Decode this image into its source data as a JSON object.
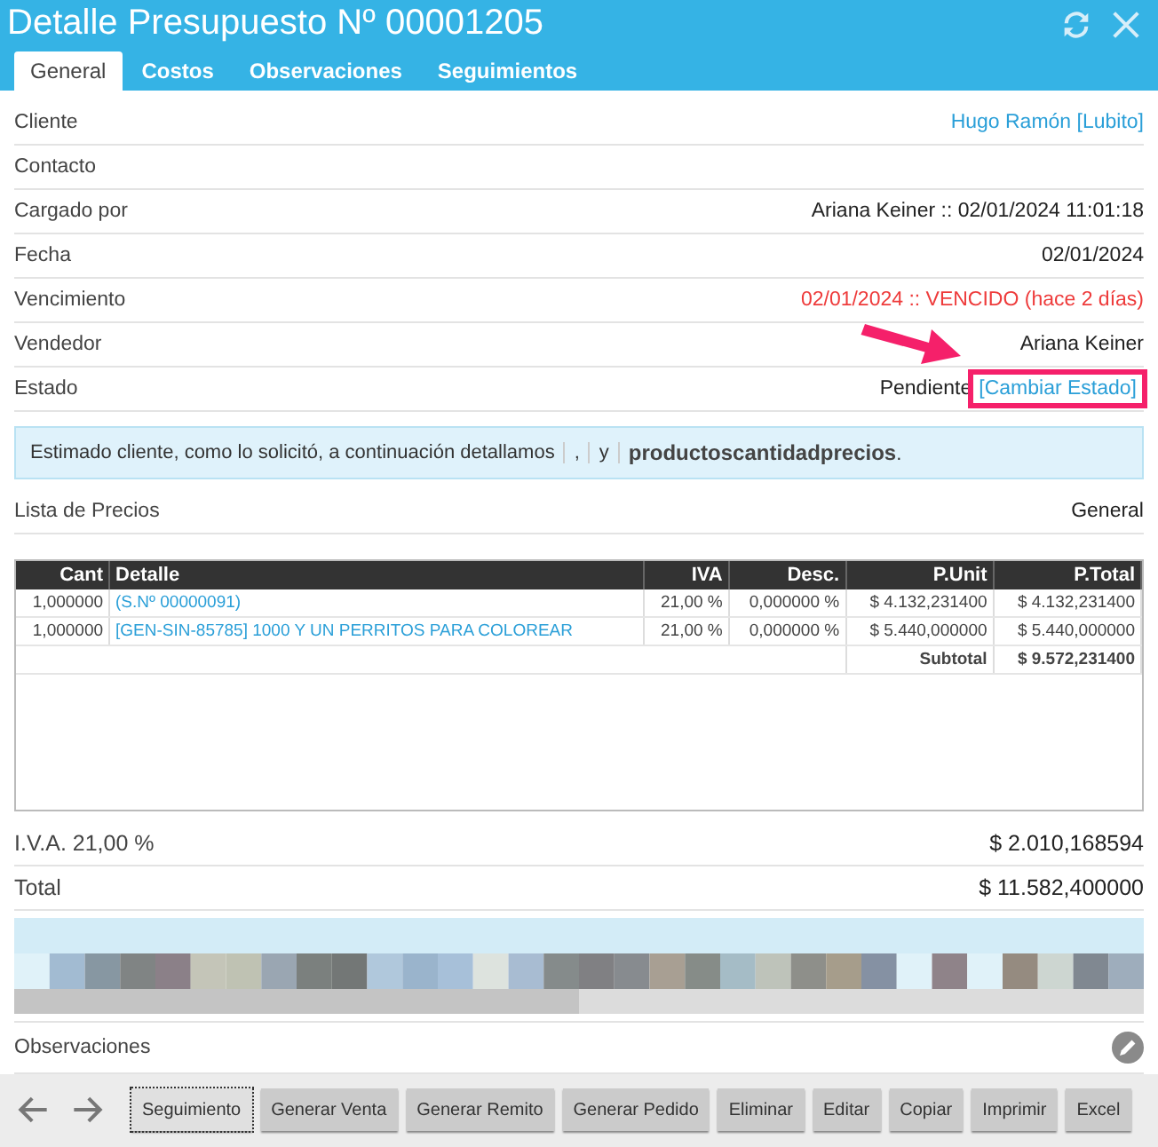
{
  "window": {
    "title": "Detalle Presupuesto Nº 00001205"
  },
  "tabs": [
    {
      "label": "General",
      "selected": true
    },
    {
      "label": "Costos",
      "selected": false
    },
    {
      "label": "Observaciones",
      "selected": false
    },
    {
      "label": "Seguimientos",
      "selected": false
    }
  ],
  "fields": [
    {
      "label": "Cliente",
      "value": "Hugo Ramón [Lubito]",
      "kind": "link"
    },
    {
      "label": "Contacto",
      "kind": "plain"
    },
    {
      "label": "Cargado por",
      "value": "Ariana Keiner :: 02/01/2024 11:01:18",
      "kind": "plain"
    },
    {
      "label": "Fecha",
      "value": "02/01/2024",
      "kind": "plain"
    },
    {
      "label": "Vencimiento",
      "value": "02/01/2024 :: VENCIDO (hace 2 días)",
      "kind": "alert"
    },
    {
      "label": "Vendedor",
      "value": "Ariana Keiner",
      "kind": "plain"
    },
    {
      "label": "Estado",
      "value": "Pendiente",
      "action": "[Cambiar Estado]",
      "kind": "status"
    }
  ],
  "message": [
    "Estimado cliente, como lo solicitó, a continuación detallamos",
    ",",
    "y",
    "**productoscantidadprecios**."
  ],
  "price_list": {
    "label": "Lista de Precios",
    "value": "General"
  },
  "table": {
    "columns": [
      "Cant",
      "Detalle",
      "IVA",
      "Desc.",
      "P.Unit",
      "P.Total"
    ],
    "rows": [
      [
        "1,000000",
        "(S.Nº 00000091)",
        "21,00 %",
        "0,000000 %",
        "$ 4.132,231400",
        "$ 4.132,231400"
      ],
      [
        "1,000000",
        "[GEN-SIN-85785] 1000 Y UN PERRITOS PARA COLOREAR",
        "21,00 %",
        "0,000000 %",
        "$ 5.440,000000",
        "$ 5.440,000000"
      ]
    ],
    "subtotal": {
      "label": "Subtotal",
      "value": "$ 9.572,231400"
    }
  },
  "totals": [
    {
      "label": "I.V.A. 21,00 %",
      "value": "$ 2.010,168594"
    },
    {
      "label": "Total",
      "value": "$ 11.582,400000"
    }
  ],
  "observations": {
    "label": "Observaciones"
  },
  "buttons": [
    {
      "label": "Seguimiento",
      "focused": true
    },
    {
      "label": "Generar Venta",
      "focused": false
    },
    {
      "label": "Generar Remito",
      "focused": false
    },
    {
      "label": "Generar Pedido",
      "focused": false
    },
    {
      "label": "Eliminar",
      "focused": false
    },
    {
      "label": "Editar",
      "focused": false
    },
    {
      "label": "Copiar",
      "focused": false
    },
    {
      "label": "Imprimir",
      "focused": false
    },
    {
      "label": "Excel",
      "focused": false
    }
  ]
}
